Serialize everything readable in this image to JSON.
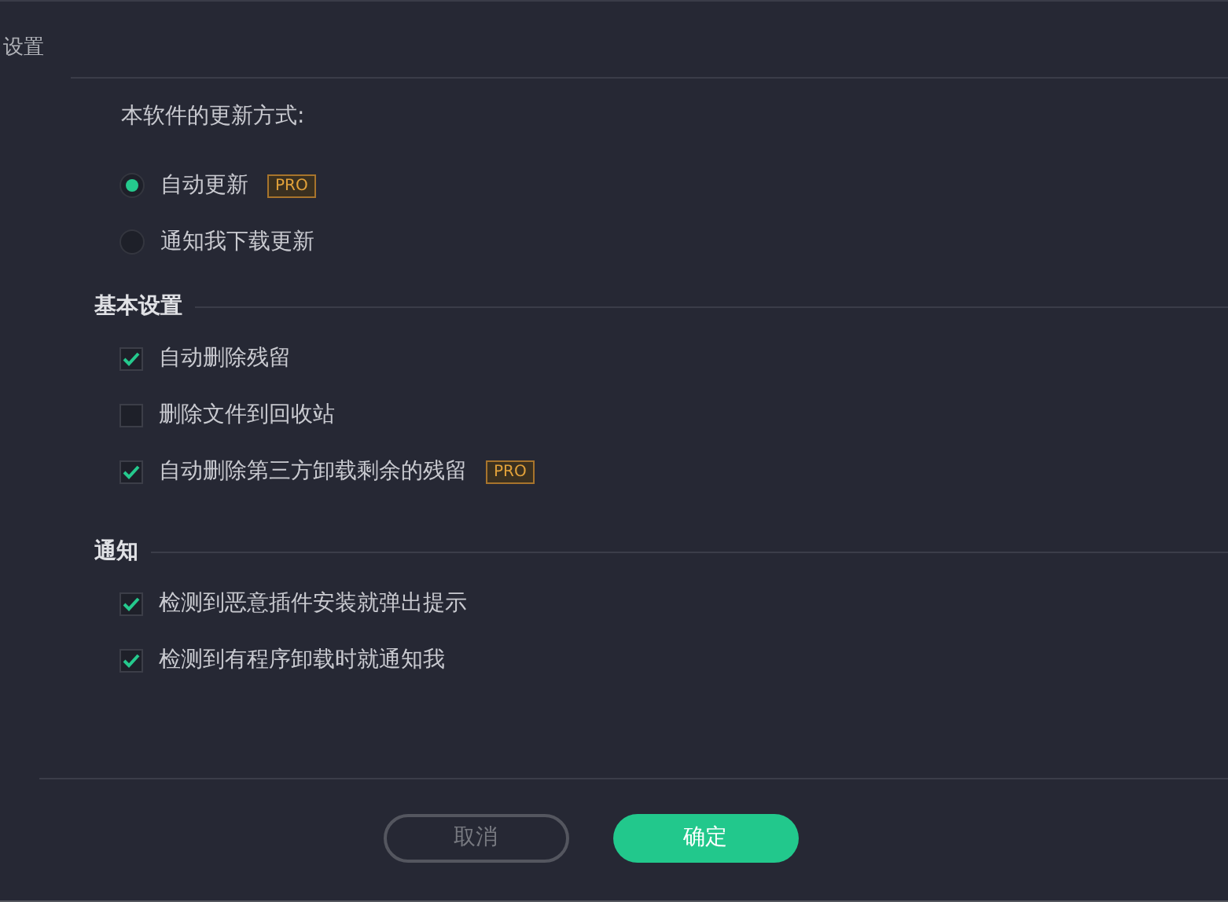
{
  "window": {
    "title": "设置"
  },
  "update": {
    "label": "本软件的更新方式:",
    "options": [
      {
        "label": "自动更新",
        "selected": true,
        "badge": "PRO"
      },
      {
        "label": "通知我下载更新",
        "selected": false
      }
    ]
  },
  "sections": [
    {
      "title": "基本设置",
      "items": [
        {
          "label": "自动删除残留",
          "checked": true
        },
        {
          "label": "删除文件到回收站",
          "checked": false
        },
        {
          "label": "自动删除第三方卸载剩余的残留",
          "checked": true,
          "badge": "PRO"
        }
      ]
    },
    {
      "title": "通知",
      "items": [
        {
          "label": "检测到恶意插件安装就弹出提示",
          "checked": true
        },
        {
          "label": "检测到有程序卸载时就通知我",
          "checked": true
        }
      ]
    }
  ],
  "buttons": [
    {
      "label": "取消",
      "kind": "secondary"
    },
    {
      "label": "确定",
      "kind": "primary"
    }
  ]
}
